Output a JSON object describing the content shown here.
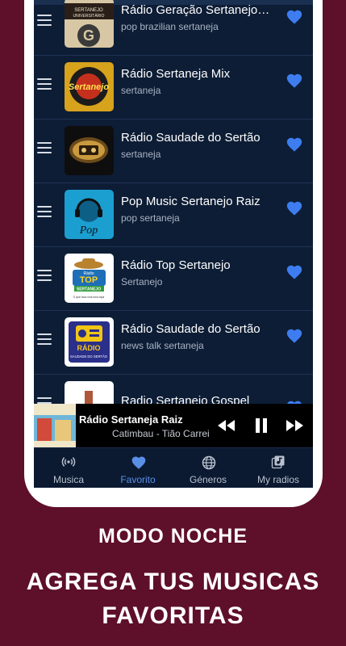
{
  "stations": [
    {
      "title": "Rádio Geração Sertanejo…",
      "genre": "pop brazilian sertaneja"
    },
    {
      "title": "Rádio Sertaneja Mix",
      "genre": "sertaneja"
    },
    {
      "title": "Rádio Saudade do Sertão",
      "genre": "sertaneja"
    },
    {
      "title": "Pop Music Sertanejo Raiz",
      "genre": "pop sertaneja"
    },
    {
      "title": "Rádio Top Sertanejo",
      "genre": "Sertanejo"
    },
    {
      "title": "Rádio Saudade do Sertão",
      "genre": "news talk sertaneja"
    },
    {
      "title": "Radio Sertanejo Gospel",
      "genre": ""
    }
  ],
  "logos": {
    "geracao": "SERTANEJO UNIVERSITÁRIO",
    "mix": "Sertanejo",
    "pop": "Pop",
    "top_radio": "Rádio",
    "top": "TOP",
    "top_sub": "SERTANEJO",
    "top_slogan": "O que toca rock toca aqui",
    "saudade": "RÁDIO",
    "saudade_sub": "SAUDADE DO SERTÃO"
  },
  "player": {
    "title": "Rádio Sertaneja Raiz",
    "artist": "Catimbau - Tião Carreiro"
  },
  "nav": {
    "musica": "Musica",
    "favorito": "Favorito",
    "generos": "Géneros",
    "myradios": "My radios"
  },
  "captions": {
    "line1": "MODO NOCHE",
    "line2a": "AGREGA TUS MUSICAS",
    "line2b": "FAVORITAS"
  },
  "colors": {
    "background": "#5e0f2a",
    "screen": "#0d1d35",
    "heart": "#3d7df0",
    "nav_active": "#5a8fe8"
  }
}
